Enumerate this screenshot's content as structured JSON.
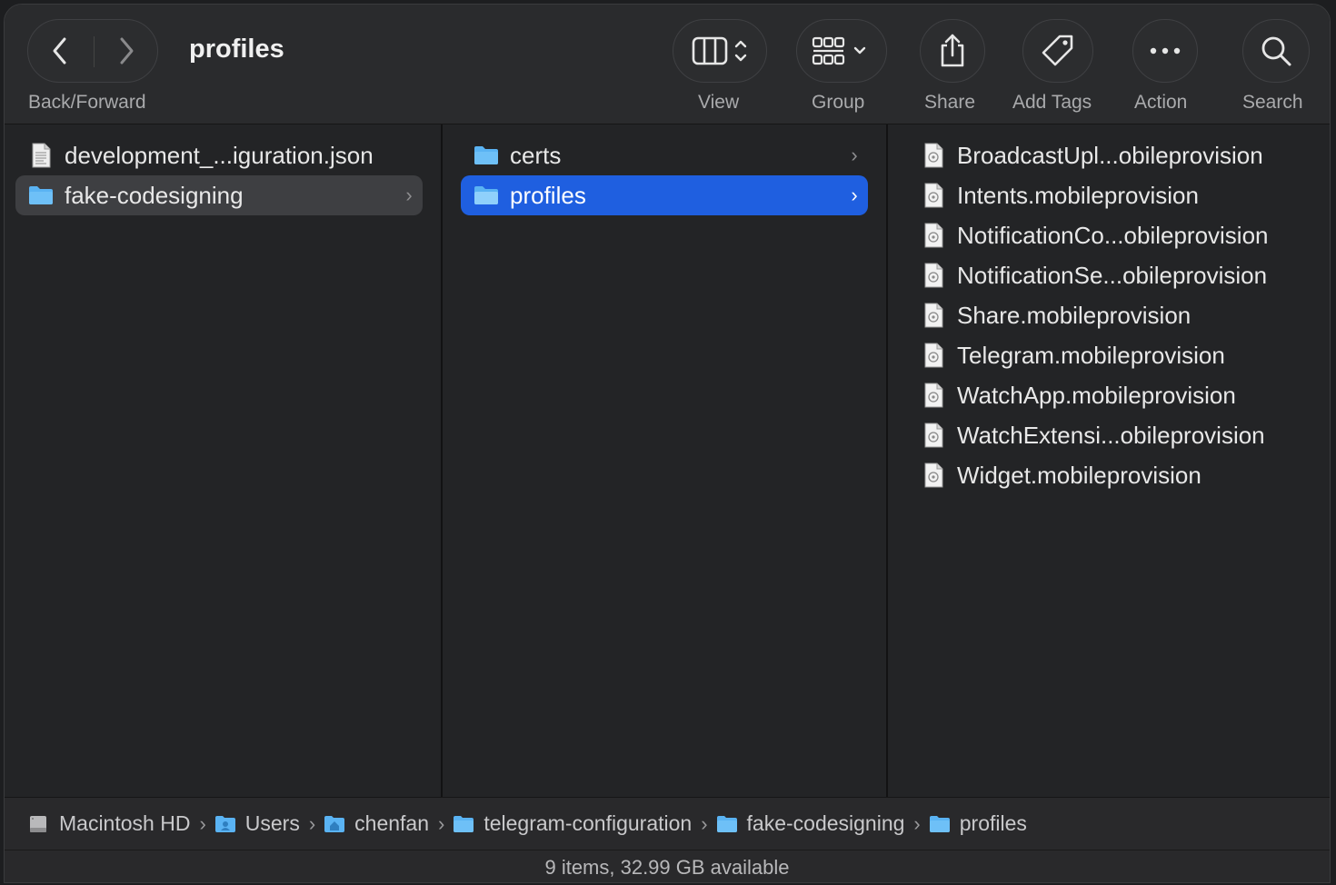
{
  "toolbar": {
    "title": "profiles",
    "back_forward_label": "Back/Forward",
    "view_label": "View",
    "group_label": "Group",
    "share_label": "Share",
    "add_tags_label": "Add Tags",
    "action_label": "Action",
    "search_label": "Search"
  },
  "columns": {
    "col1": [
      {
        "name": "development_...iguration.json",
        "icon": "json-file-icon"
      },
      {
        "name": "fake-codesigning",
        "icon": "folder-icon",
        "selected": "inactive"
      }
    ],
    "col2": [
      {
        "name": "certs",
        "icon": "folder-icon"
      },
      {
        "name": "profiles",
        "icon": "folder-icon",
        "selected": "active"
      }
    ],
    "col3": [
      {
        "name": "BroadcastUpl...obileprovision"
      },
      {
        "name": "Intents.mobileprovision"
      },
      {
        "name": "NotificationCo...obileprovision"
      },
      {
        "name": "NotificationSe...obileprovision"
      },
      {
        "name": "Share.mobileprovision"
      },
      {
        "name": "Telegram.mobileprovision"
      },
      {
        "name": "WatchApp.mobileprovision"
      },
      {
        "name": "WatchExtensi...obileprovision"
      },
      {
        "name": "Widget.mobileprovision"
      }
    ]
  },
  "pathbar": {
    "items": [
      {
        "label": "Macintosh HD",
        "icon": "disk-icon"
      },
      {
        "label": "Users",
        "icon": "users-folder-icon"
      },
      {
        "label": "chenfan",
        "icon": "home-folder-icon"
      },
      {
        "label": "telegram-configuration",
        "icon": "folder-icon"
      },
      {
        "label": "fake-codesigning",
        "icon": "folder-icon"
      },
      {
        "label": "profiles",
        "icon": "folder-icon"
      }
    ]
  },
  "status": "9 items, 32.99 GB available",
  "colors": {
    "selection_active": "#1f5fe0",
    "selection_inactive": "#3e3f42",
    "folder": "#5ab3f3"
  }
}
